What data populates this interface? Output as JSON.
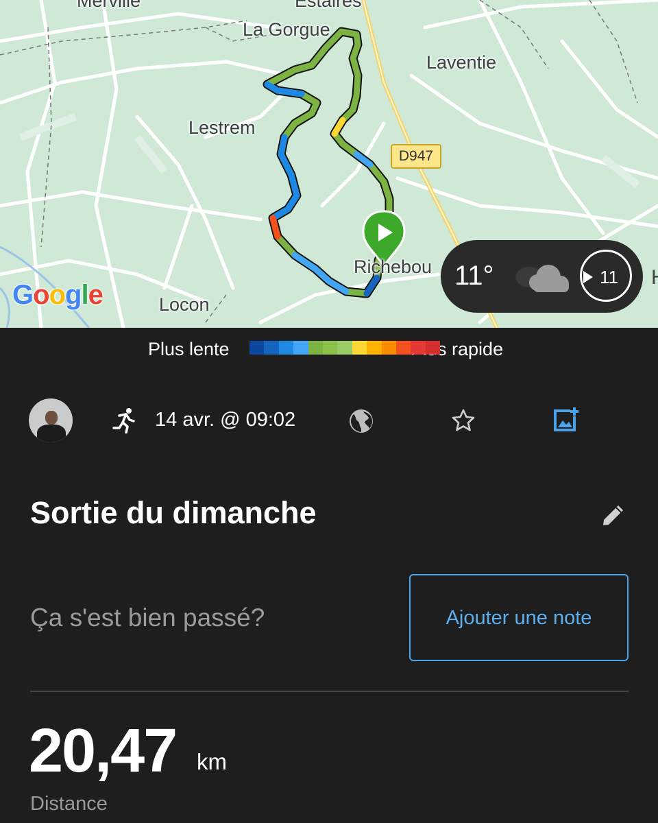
{
  "map": {
    "places": {
      "merville": "Merville",
      "estaires": "Estaires",
      "la_gorgue": "La Gorgue",
      "laventie": "Laventie",
      "lestrem": "Lestrem",
      "richebourg": "Richebou",
      "locon": "Locon",
      "edge_letter": "H"
    },
    "road_badge": "D947",
    "attribution": [
      "G",
      "o",
      "o",
      "g",
      "l",
      "e"
    ],
    "attribution_colors": [
      "#4285F4",
      "#EA4335",
      "#FBBC05",
      "#4285F4",
      "#34A853",
      "#EA4335"
    ],
    "weather": {
      "temperature": "11°",
      "icon": "cloud-icon",
      "wind": "11"
    }
  },
  "legend": {
    "slow_label": "Plus lente",
    "fast_label": "Plus rapide",
    "scale_colors": [
      "#0d47a1",
      "#1565c0",
      "#1e88e5",
      "#42a5f5",
      "#7cb342",
      "#8bc34a",
      "#9ccc65",
      "#fdd835",
      "#ffb300",
      "#fb8c00",
      "#f4511e",
      "#e53935",
      "#d32f2f"
    ]
  },
  "activity": {
    "type_icon": "runner-icon",
    "datetime": "14 avr. @ 09:02",
    "title": "Sortie du dimanche",
    "feeling_prompt": "Ça s'est bien passé?",
    "add_note_label": "Ajouter une note",
    "distance_value": "20,47",
    "distance_unit": "km",
    "distance_label": "Distance"
  }
}
